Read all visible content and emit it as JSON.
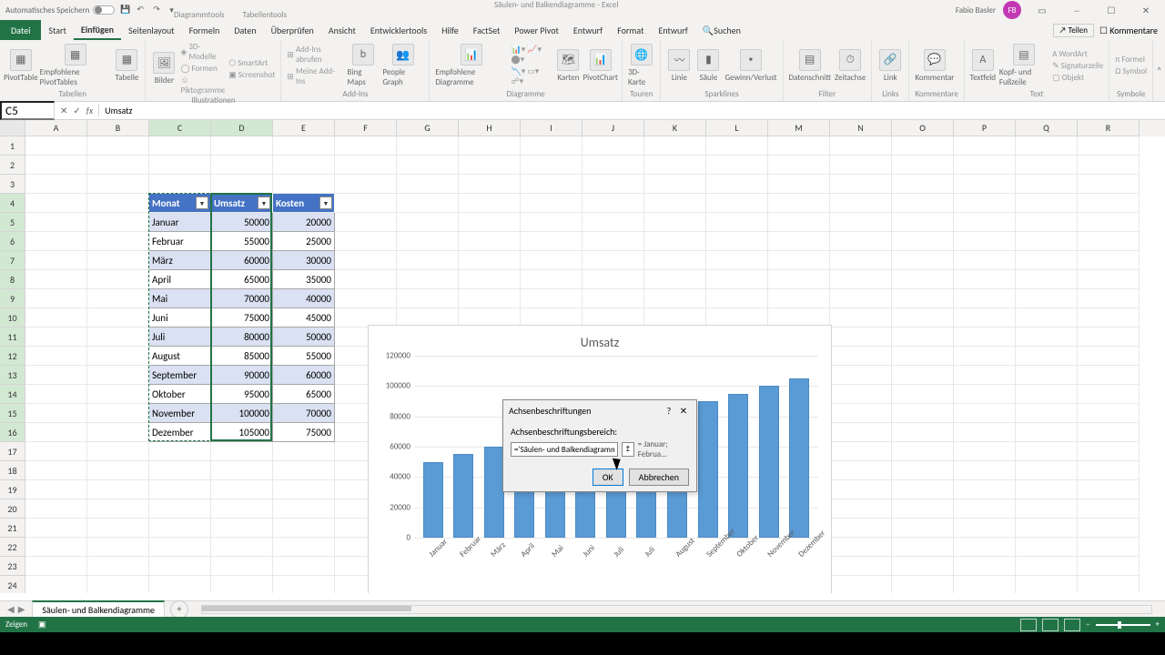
{
  "title_bar": {
    "autosave": "Automatisches Speichern",
    "doc_title": "Säulen- und Balkendiagramme - Excel",
    "context1": "Diagrammtools",
    "context2": "Tabellentools",
    "user": "Fabio Basler",
    "avatar": "FB"
  },
  "tabs": {
    "file": "Datei",
    "start": "Start",
    "einfuegen": "Einfügen",
    "layout": "Seitenlayout",
    "formeln": "Formeln",
    "daten": "Daten",
    "ueberpruefen": "Überprüfen",
    "ansicht": "Ansicht",
    "entwickler": "Entwicklertools",
    "hilfe": "Hilfe",
    "factset": "FactSet",
    "powerpivot": "Power Pivot",
    "entwurf": "Entwurf",
    "format": "Format",
    "entwurf2": "Entwurf",
    "search": "Suchen",
    "share": "Teilen",
    "comments": "Kommentare"
  },
  "ribbon": {
    "tabellen": "Tabellen",
    "pivot": "PivotTable",
    "empf_pivot": "Empfohlene PivotTables",
    "tabelle": "Tabelle",
    "illustrationen": "Illustrationen",
    "bilder": "Bilder",
    "formen": "Formen",
    "smartart": "SmartArt",
    "screenshot": "Screenshot",
    "_3d": "3D-Modelle",
    "addins": "Add-Ins",
    "addins_get": "Add-Ins abrufen",
    "my_addins": "Meine Add-Ins",
    "bing": "Bing Maps",
    "people": "People Graph",
    "diagramme": "Diagramme",
    "empf_diag": "Empfohlene Diagramme",
    "pivotchart": "PivotChart",
    "karten": "Karten",
    "_3dkarte": "3D-Karte",
    "touren": "Touren",
    "sparklines": "Sparklines",
    "linie": "Linie",
    "saeule": "Säule",
    "gev": "Gewinn/Verlust",
    "filter": "Filter",
    "datenschnitt": "Datenschnitt",
    "zeitachse": "Zeitachse",
    "links": "Links",
    "link": "Link",
    "kommentare_g": "Kommentare",
    "kommentar": "Kommentar",
    "text": "Text",
    "textfeld": "Textfeld",
    "kopf": "Kopf- und Fußzeile",
    "wordart": "WordArt",
    "signatur": "Signaturzeile",
    "objekt": "Objekt",
    "symbole": "Symbole",
    "formel": "Formel",
    "symbol": "Symbol"
  },
  "formula": {
    "name_box": "C5",
    "value": "Umsatz"
  },
  "columns": [
    "A",
    "B",
    "C",
    "D",
    "E",
    "F",
    "G",
    "H",
    "I",
    "J",
    "K",
    "L",
    "M",
    "N",
    "O",
    "P",
    "Q",
    "R"
  ],
  "table": {
    "headers": [
      "Monat",
      "Umsatz",
      "Kosten"
    ],
    "rows": [
      [
        "Januar",
        50000,
        20000
      ],
      [
        "Februar",
        55000,
        25000
      ],
      [
        "März",
        60000,
        30000
      ],
      [
        "April",
        65000,
        35000
      ],
      [
        "Mai",
        70000,
        40000
      ],
      [
        "Juni",
        75000,
        45000
      ],
      [
        "Juli",
        80000,
        50000
      ],
      [
        "August",
        85000,
        55000
      ],
      [
        "September",
        90000,
        60000
      ],
      [
        "Oktober",
        95000,
        65000
      ],
      [
        "November",
        100000,
        70000
      ],
      [
        "Dezember",
        105000,
        75000
      ]
    ]
  },
  "chart_data": {
    "type": "bar",
    "title": "Umsatz",
    "categories": [
      "Januar",
      "Februar",
      "März",
      "April",
      "Mai",
      "Juni",
      "Juli",
      "Juli",
      "August",
      "September",
      "Oktober",
      "November",
      "Dezember"
    ],
    "values": [
      50000,
      55000,
      60000,
      65000,
      70000,
      75000,
      80000,
      80000,
      85000,
      90000,
      95000,
      100000,
      105000
    ],
    "ylim": [
      0,
      120000
    ],
    "yticks": [
      0,
      20000,
      40000,
      60000,
      80000,
      100000,
      120000
    ],
    "xlabel": "",
    "ylabel": ""
  },
  "dialog": {
    "title": "Achsenbeschriftungen",
    "help": "?",
    "close": "✕",
    "label": "Achsenbeschriftungsbereich:",
    "input": "='Säulen- und Balkendiagramme",
    "preview": "= Januar; Februa...",
    "ok": "OK",
    "cancel": "Abbrechen"
  },
  "sheet": {
    "name": "Säulen- und Balkendiagramme"
  },
  "status": {
    "mode": "Zeigen"
  }
}
